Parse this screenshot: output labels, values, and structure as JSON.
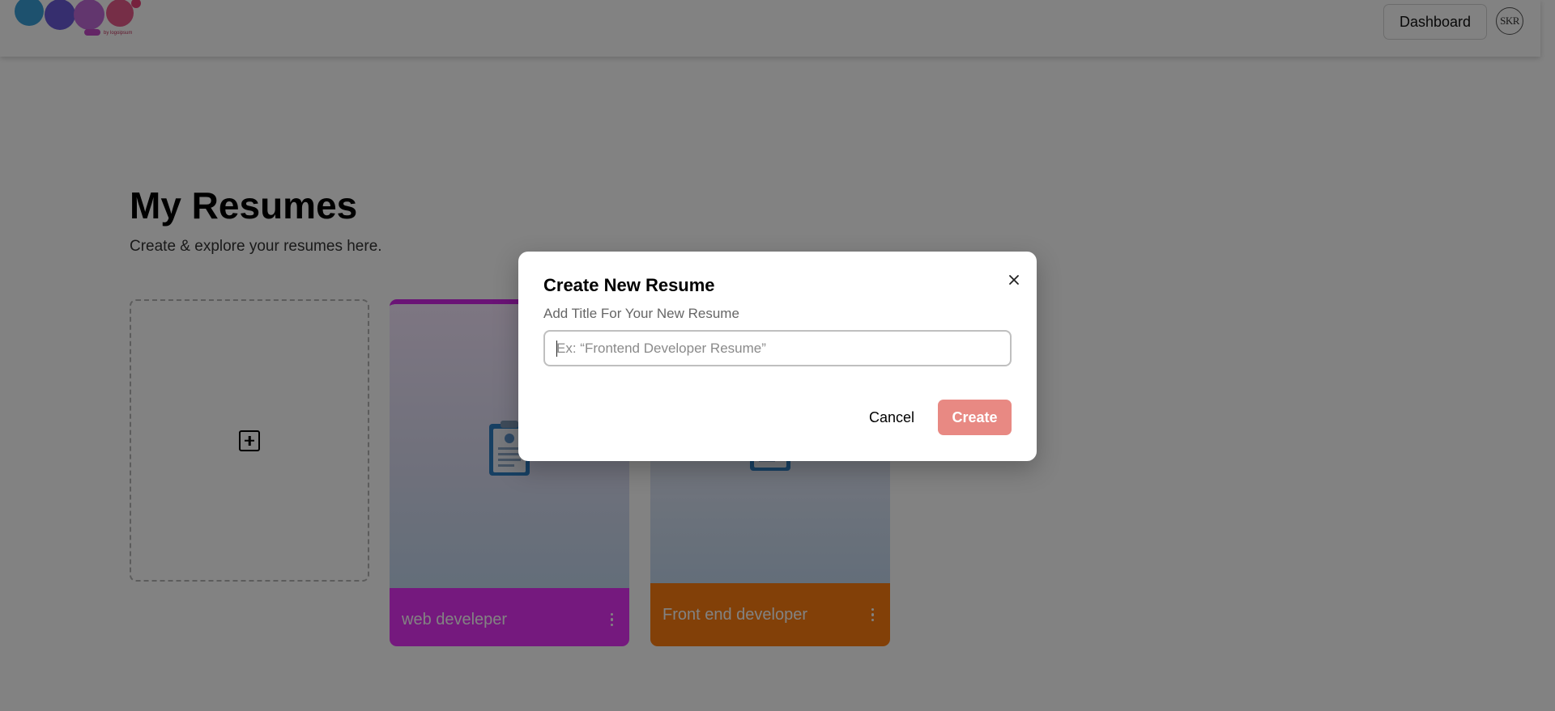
{
  "header": {
    "logo_text": "Logo",
    "logo_by": "by logoipsum",
    "dashboard_label": "Dashboard",
    "avatar_initials": "SKR"
  },
  "main": {
    "title": "My Resumes",
    "subtitle": "Create & explore your resumes here.",
    "resumes": [
      {
        "title": "web develeper",
        "accent_color": "#e632f7"
      },
      {
        "title": "Front end developer",
        "accent_color": "#ff7f11"
      }
    ]
  },
  "modal": {
    "title": "Create New Resume",
    "description": "Add Title For Your New Resume",
    "input_placeholder": "Ex: “Frontend Developer Resume”",
    "input_value": "",
    "cancel_label": "Cancel",
    "create_label": "Create",
    "create_color": "#e88983"
  },
  "icons": {
    "add": "plus-square-icon",
    "close": "close-icon",
    "resume": "clipboard-document-icon",
    "menu": "more-vertical-icon"
  }
}
